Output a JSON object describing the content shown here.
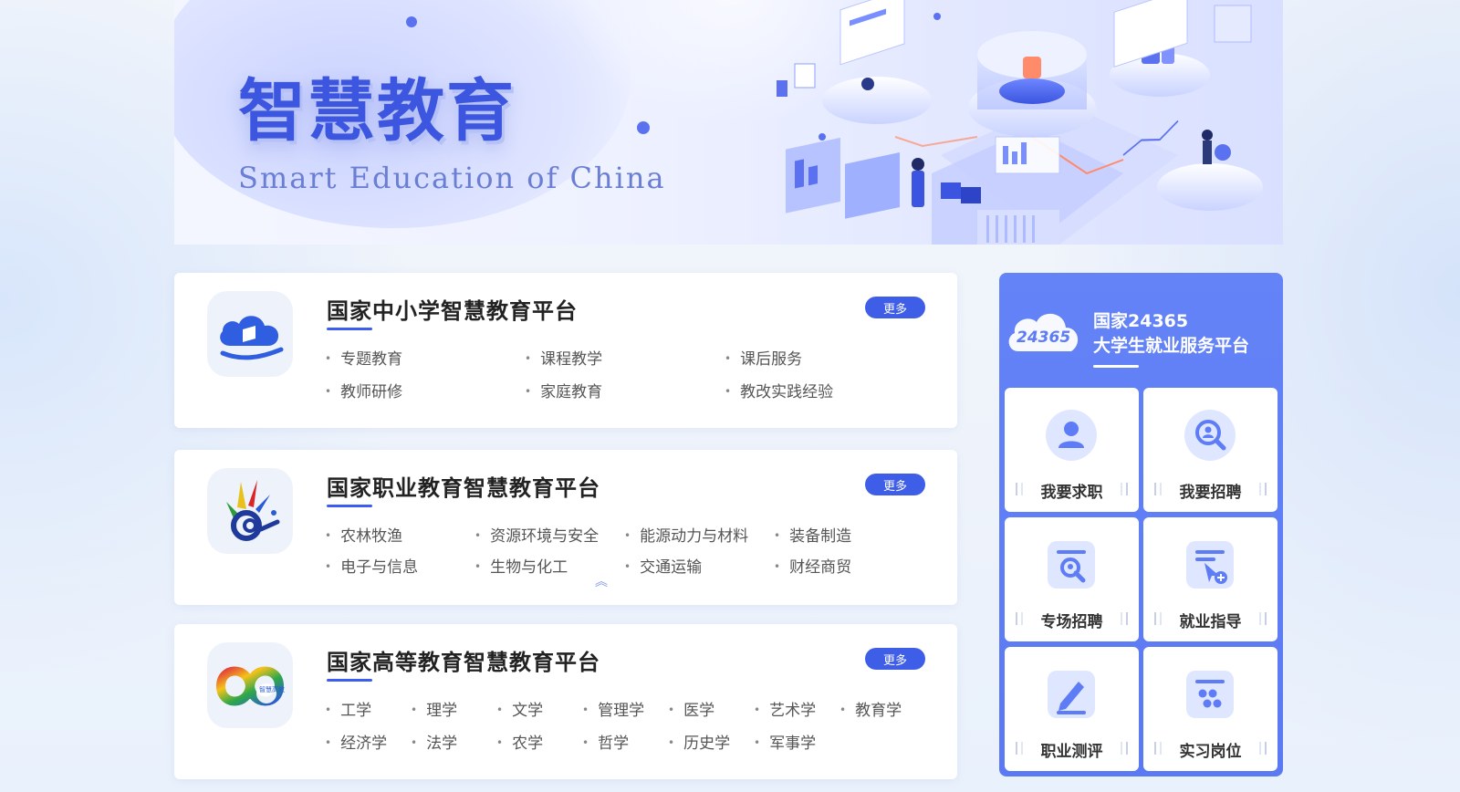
{
  "banner": {
    "title": "智慧教育",
    "subtitle": "Smart Education of China"
  },
  "cards": [
    {
      "title": "国家中小学智慧教育平台",
      "more_label": "更多",
      "logo_icon": "cloud-book-icon",
      "items": [
        "专题教育",
        "课程教学",
        "课后服务",
        "教师研修",
        "家庭教育",
        "教改实践经验"
      ]
    },
    {
      "title": "国家职业教育智慧教育平台",
      "more_label": "更多",
      "logo_icon": "colorful-hand-icon",
      "items": [
        "农林牧渔",
        "资源环境与安全",
        "能源动力与材料",
        "装备制造",
        "电子与信息",
        "生物与化工",
        "交通运输",
        "财经商贸"
      ]
    },
    {
      "title": "国家高等教育智慧教育平台",
      "more_label": "更多",
      "logo_icon": "infinity-rainbow-icon",
      "logo_text": "智慧高教",
      "items": [
        "工学",
        "理学",
        "文学",
        "管理学",
        "医学",
        "艺术学",
        "教育学",
        "经济学",
        "法学",
        "农学",
        "哲学",
        "历史学",
        "军事学"
      ]
    }
  ],
  "employment": {
    "cloud_text": "24365",
    "title_line1": "国家24365",
    "title_line2": "大学生就业服务平台",
    "tiles": [
      {
        "label": "我要求职",
        "icon": "person-icon"
      },
      {
        "label": "我要招聘",
        "icon": "search-person-icon"
      },
      {
        "label": "专场招聘",
        "icon": "special-recruit-icon"
      },
      {
        "label": "就业指导",
        "icon": "guidance-cursor-icon"
      },
      {
        "label": "职业测评",
        "icon": "pen-icon"
      },
      {
        "label": "实习岗位",
        "icon": "internship-dots-icon"
      }
    ]
  },
  "colors": {
    "accent": "#3f5ee8",
    "panel": "#5d7cf5",
    "banner_title": "#3d56e0"
  }
}
